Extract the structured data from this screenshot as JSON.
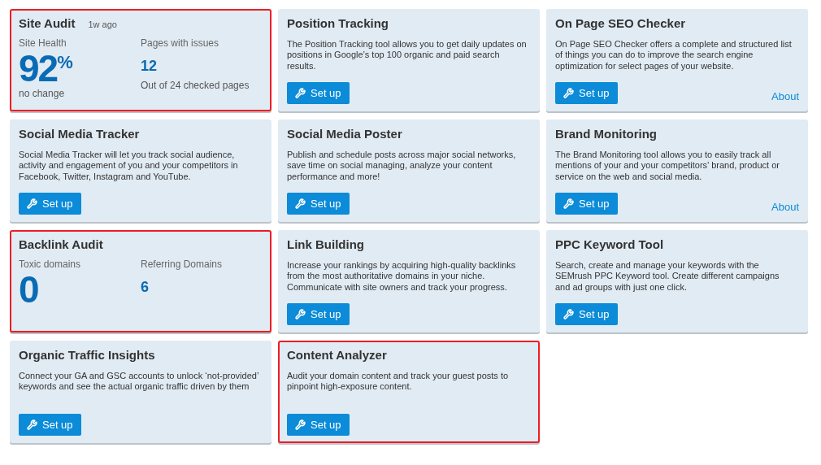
{
  "cards": [
    {
      "kind": "stats",
      "title": "Site Audit",
      "badge": "1w ago",
      "highlighted": true,
      "metrics": [
        {
          "label": "Site Health",
          "value": "92",
          "unit": "%",
          "note": "no change"
        },
        {
          "label": "Pages with issues",
          "value": "12",
          "note": "Out of 24 checked pages"
        }
      ]
    },
    {
      "kind": "tool",
      "title": "Position Tracking",
      "highlighted": false,
      "description": "The Position Tracking tool allows you to get daily updates on positions in Google’s top 100 organic and paid search results.",
      "button": "Set up"
    },
    {
      "kind": "tool",
      "title": "On Page SEO Checker",
      "highlighted": false,
      "description": "On Page SEO Checker offers a complete and structured list of things you can do to improve the search engine optimization for select pages of your website.",
      "button": "Set up",
      "link": "About"
    },
    {
      "kind": "tool",
      "title": "Social Media Tracker",
      "highlighted": false,
      "description": "Social Media Tracker will let you track social audience, activity and engagement of you and your competitors in Facebook, Twitter, Instagram and YouTube.",
      "button": "Set up"
    },
    {
      "kind": "tool",
      "title": "Social Media Poster",
      "highlighted": false,
      "description": "Publish and schedule posts across major social networks, save time on social managing, analyze your content performance and more!",
      "button": "Set up"
    },
    {
      "kind": "tool",
      "title": "Brand Monitoring",
      "highlighted": false,
      "description": "The Brand Monitoring tool allows you to easily track all mentions of your and your competitors’ brand, product or service on the web and social media.",
      "button": "Set up",
      "link": "About"
    },
    {
      "kind": "stats",
      "title": "Backlink Audit",
      "highlighted": true,
      "metrics": [
        {
          "label": "Toxic domains",
          "value": "0"
        },
        {
          "label": "Referring Domains",
          "value": "6"
        }
      ]
    },
    {
      "kind": "tool",
      "title": "Link Building",
      "highlighted": false,
      "description": "Increase your rankings by acquiring high-quality backlinks from the most authoritative domains in your niche. Communicate with site owners and track your progress.",
      "button": "Set up"
    },
    {
      "kind": "tool",
      "title": "PPC Keyword Tool",
      "highlighted": false,
      "description": "Search, create and manage your keywords with the SEMrush PPC Keyword tool. Create different campaigns and ad groups with just one click.",
      "button": "Set up"
    },
    {
      "kind": "tool",
      "title": "Organic Traffic Insights",
      "highlighted": false,
      "description": "Connect your GA and GSC accounts to unlock ‘not-provided’ keywords and see the actual organic traffic driven by them",
      "button": "Set up"
    },
    {
      "kind": "tool",
      "title": "Content Analyzer",
      "highlighted": true,
      "description": "Audit your domain content and track your guest posts to pinpoint high-exposure content.",
      "button": "Set up"
    }
  ]
}
